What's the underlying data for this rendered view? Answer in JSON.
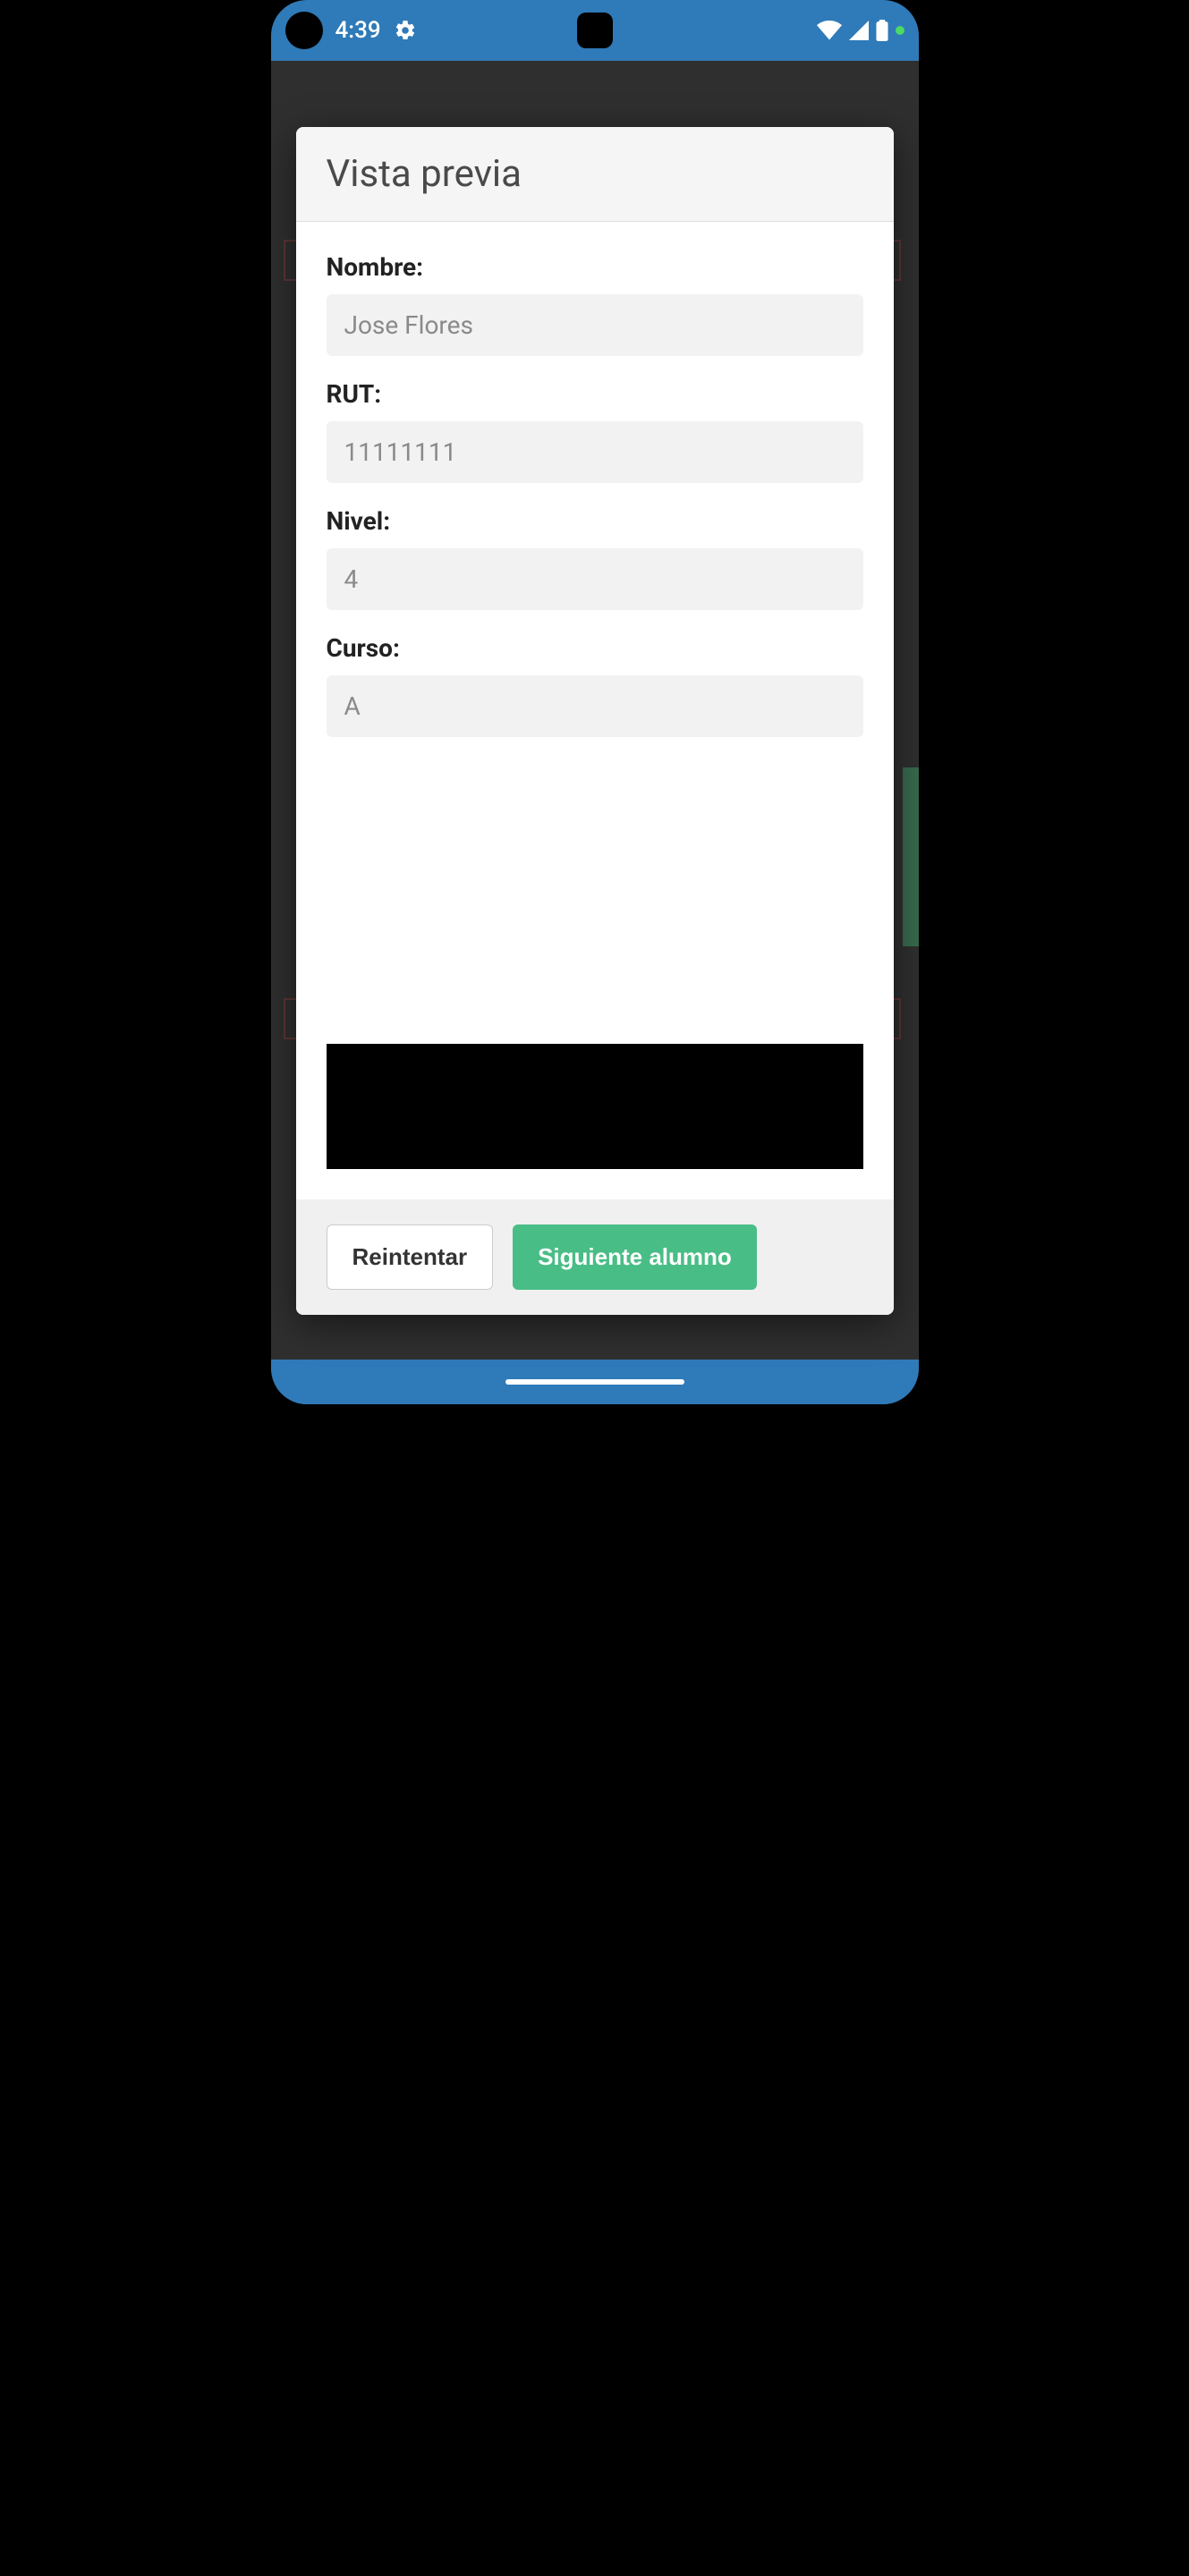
{
  "status": {
    "time": "4:39"
  },
  "dialog": {
    "title": "Vista previa",
    "fields": {
      "nombre": {
        "label": "Nombre:",
        "value": "Jose Flores"
      },
      "rut": {
        "label": "RUT:",
        "value": "11111111"
      },
      "nivel": {
        "label": "Nivel:",
        "value": "4"
      },
      "curso": {
        "label": "Curso:",
        "value": "A"
      }
    },
    "buttons": {
      "retry": "Reintentar",
      "next": "Siguiente alumno"
    }
  }
}
